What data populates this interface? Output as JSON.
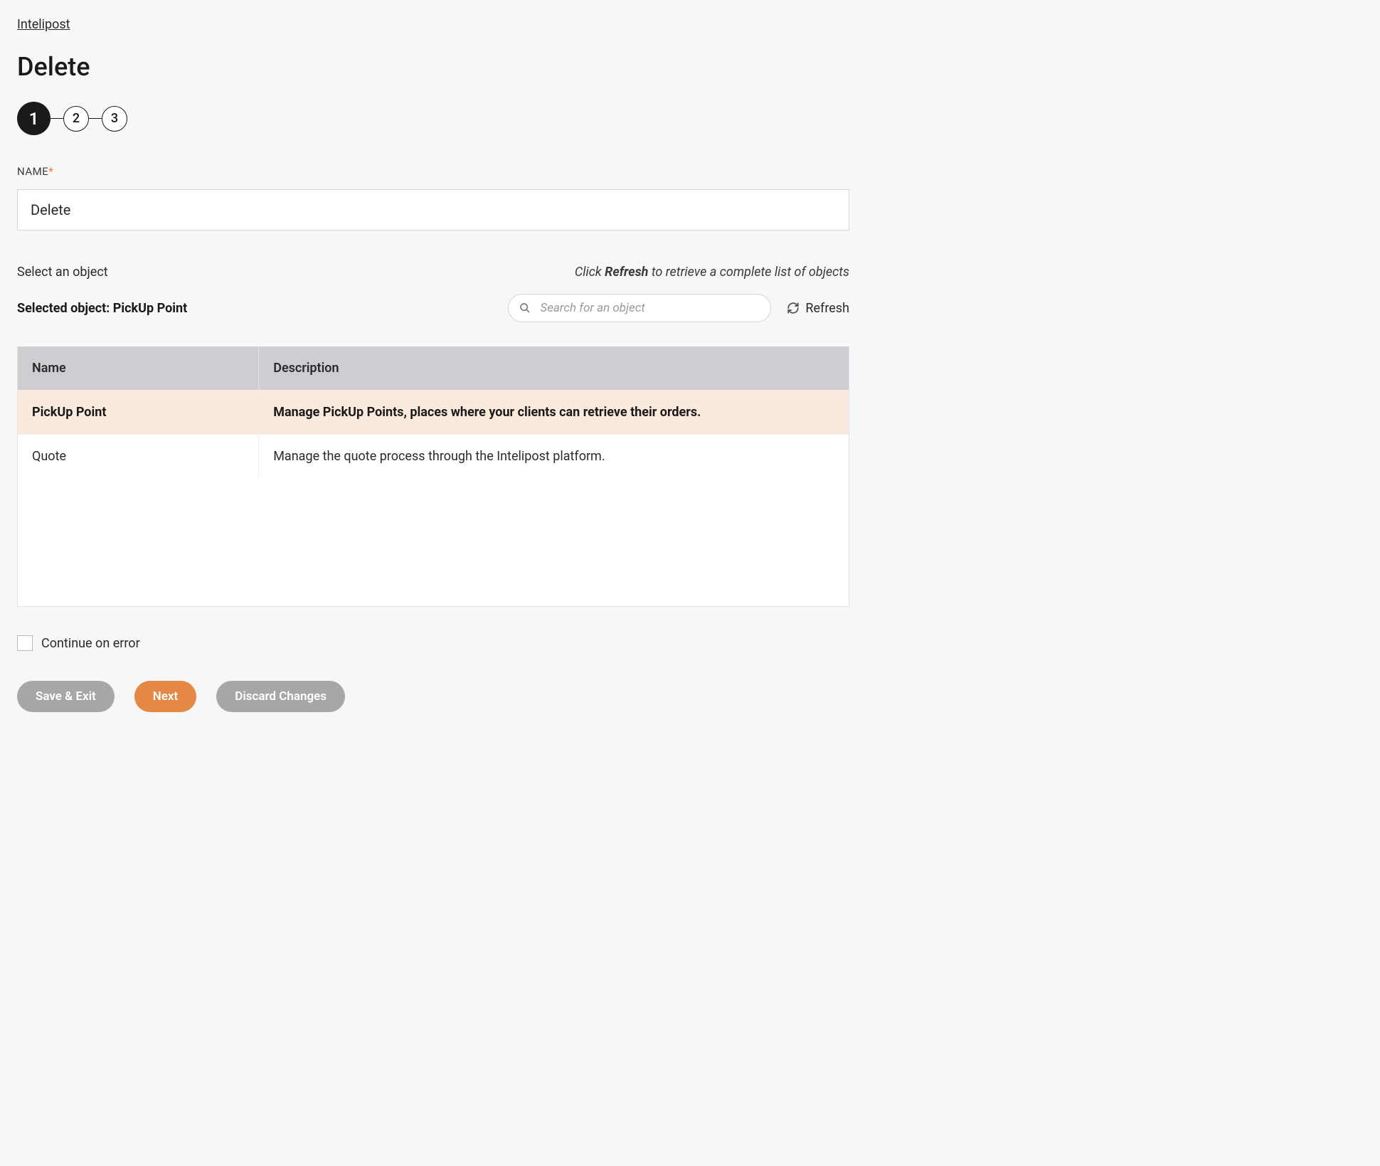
{
  "breadcrumb": "Intelipost",
  "page_title": "Delete",
  "stepper": {
    "steps": [
      "1",
      "2",
      "3"
    ],
    "active_index": 0
  },
  "name_field": {
    "label": "NAME",
    "value": "Delete"
  },
  "select_object": {
    "prompt": "Select an object",
    "hint_prefix": "Click ",
    "hint_bold": "Refresh",
    "hint_suffix": " to retrieve a complete list of objects",
    "selected_label_prefix": "Selected object: ",
    "selected_value": "PickUp Point",
    "search_placeholder": "Search for an object",
    "refresh_label": "Refresh"
  },
  "table": {
    "headers": {
      "name": "Name",
      "description": "Description"
    },
    "rows": [
      {
        "name": "PickUp Point",
        "description": "Manage PickUp Points, places where your clients can retrieve their orders.",
        "selected": true
      },
      {
        "name": "Quote",
        "description": "Manage the quote process through the Intelipost platform.",
        "selected": false
      }
    ]
  },
  "continue_on_error": {
    "label": "Continue on error",
    "checked": false
  },
  "buttons": {
    "save_exit": "Save & Exit",
    "next": "Next",
    "discard": "Discard Changes"
  }
}
